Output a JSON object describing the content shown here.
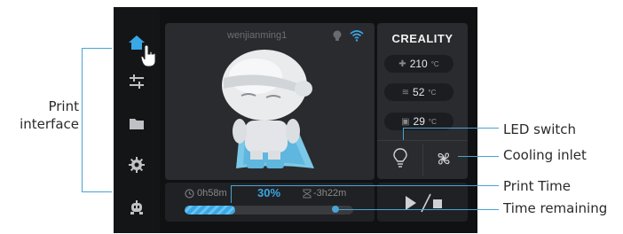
{
  "annotations": {
    "print_interface": "Print\ninterface",
    "led_switch": "LED switch",
    "cooling_inlet": "Cooling inlet",
    "print_time": "Print Time",
    "time_remaining": "Time remaining"
  },
  "header": {
    "username": "wenjianming1"
  },
  "brand": {
    "logo": "CREALITY"
  },
  "temps": [
    {
      "icon": "nozzle-icon",
      "value": "210",
      "unit": "°C"
    },
    {
      "icon": "bed-icon",
      "value": "52",
      "unit": "°C"
    },
    {
      "icon": "chamber-icon",
      "value": "29",
      "unit": "°C"
    }
  ],
  "progress": {
    "elapsed": "0h58m",
    "percent_label": "30%",
    "percent": 30,
    "remaining": "-3h22m"
  },
  "sidebar": {
    "items": [
      {
        "icon": "home-icon",
        "active": true
      },
      {
        "icon": "sliders-icon",
        "active": false
      },
      {
        "icon": "folder-icon",
        "active": false
      },
      {
        "icon": "gear-icon",
        "active": false
      },
      {
        "icon": "robot-icon",
        "active": false
      }
    ]
  },
  "colors": {
    "accent": "#3aa7e6",
    "annotation_line": "#4aa3d3"
  }
}
